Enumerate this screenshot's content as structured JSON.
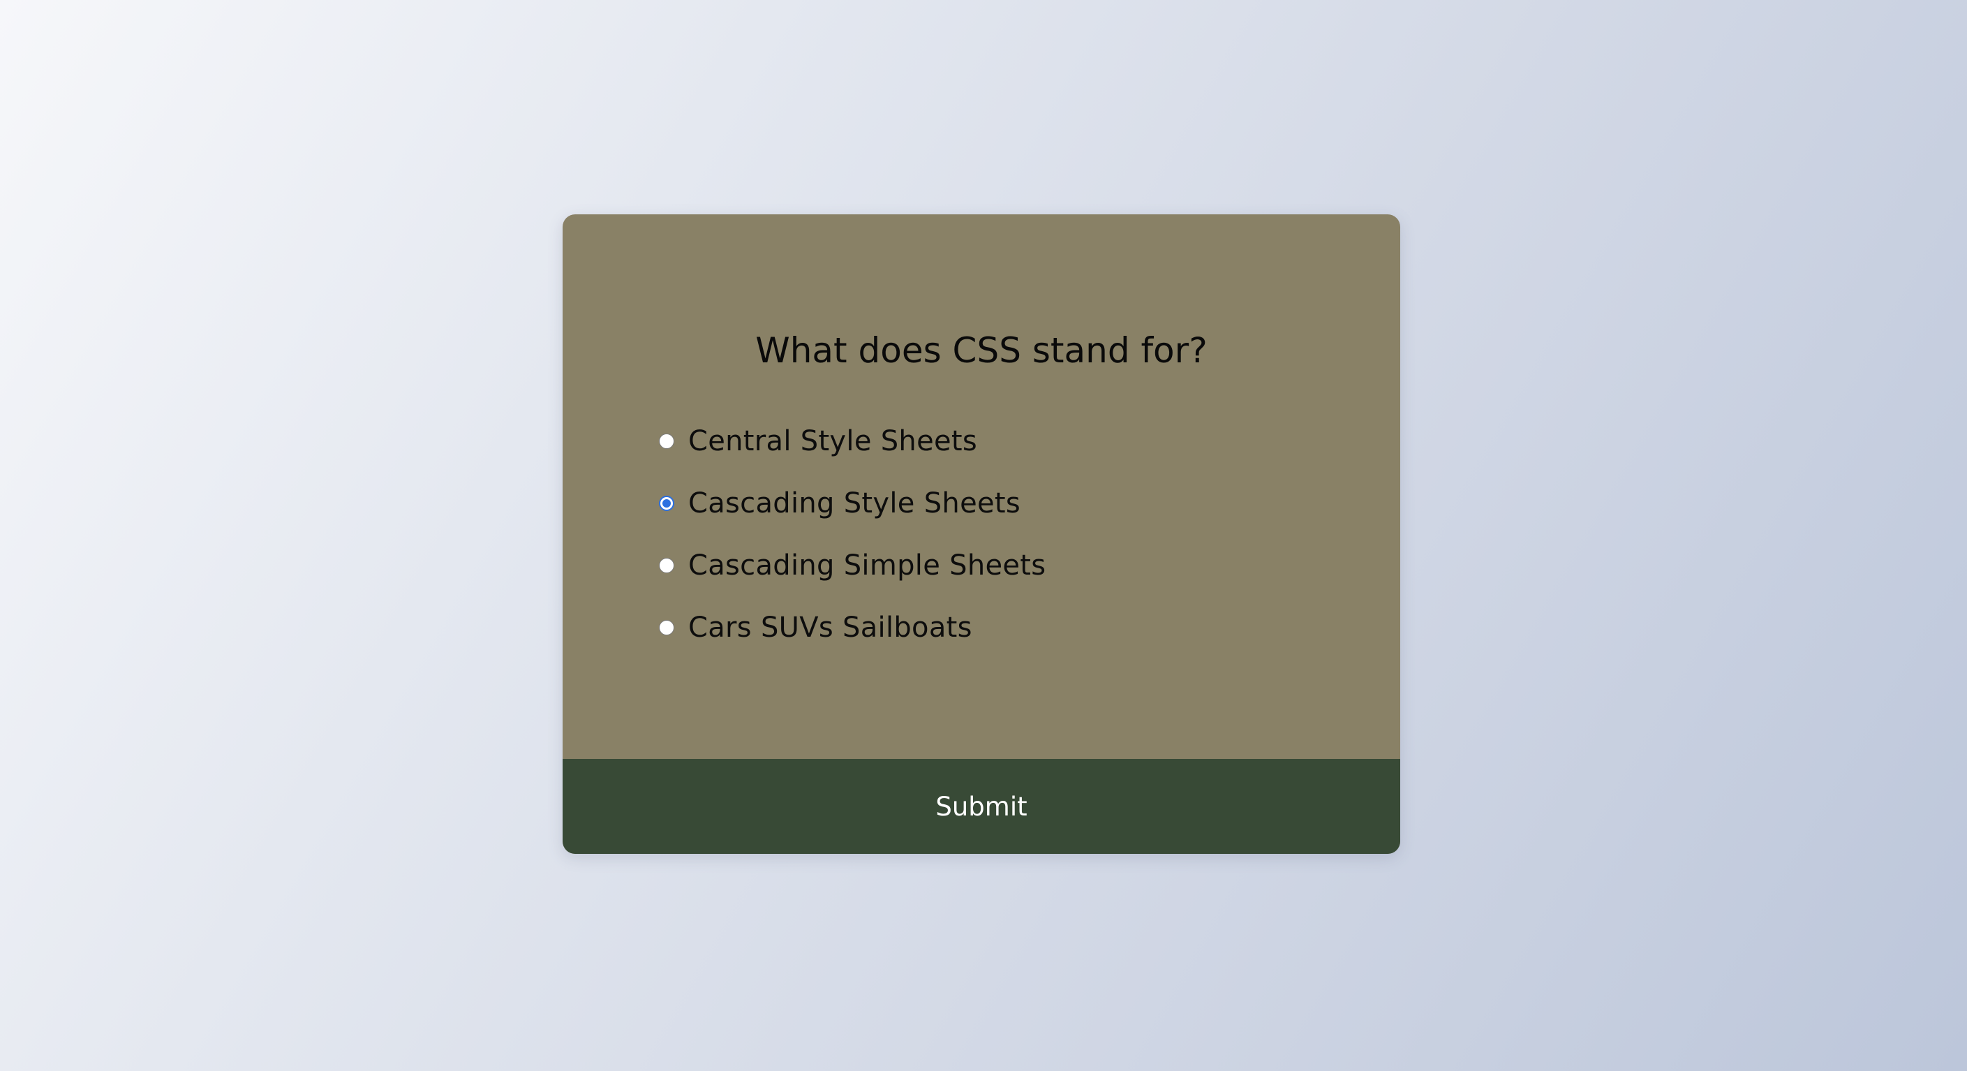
{
  "quiz": {
    "question": "What does CSS stand for?",
    "answers": [
      {
        "label": "Central Style Sheets",
        "selected": false
      },
      {
        "label": "Cascading Style Sheets",
        "selected": true
      },
      {
        "label": "Cascading Simple Sheets",
        "selected": false
      },
      {
        "label": "Cars SUVs Sailboats",
        "selected": false
      }
    ],
    "submit_label": "Submit"
  },
  "colors": {
    "card_background": "#898166",
    "submit_background": "#384a36",
    "radio_selected": "#2b6fe0"
  }
}
